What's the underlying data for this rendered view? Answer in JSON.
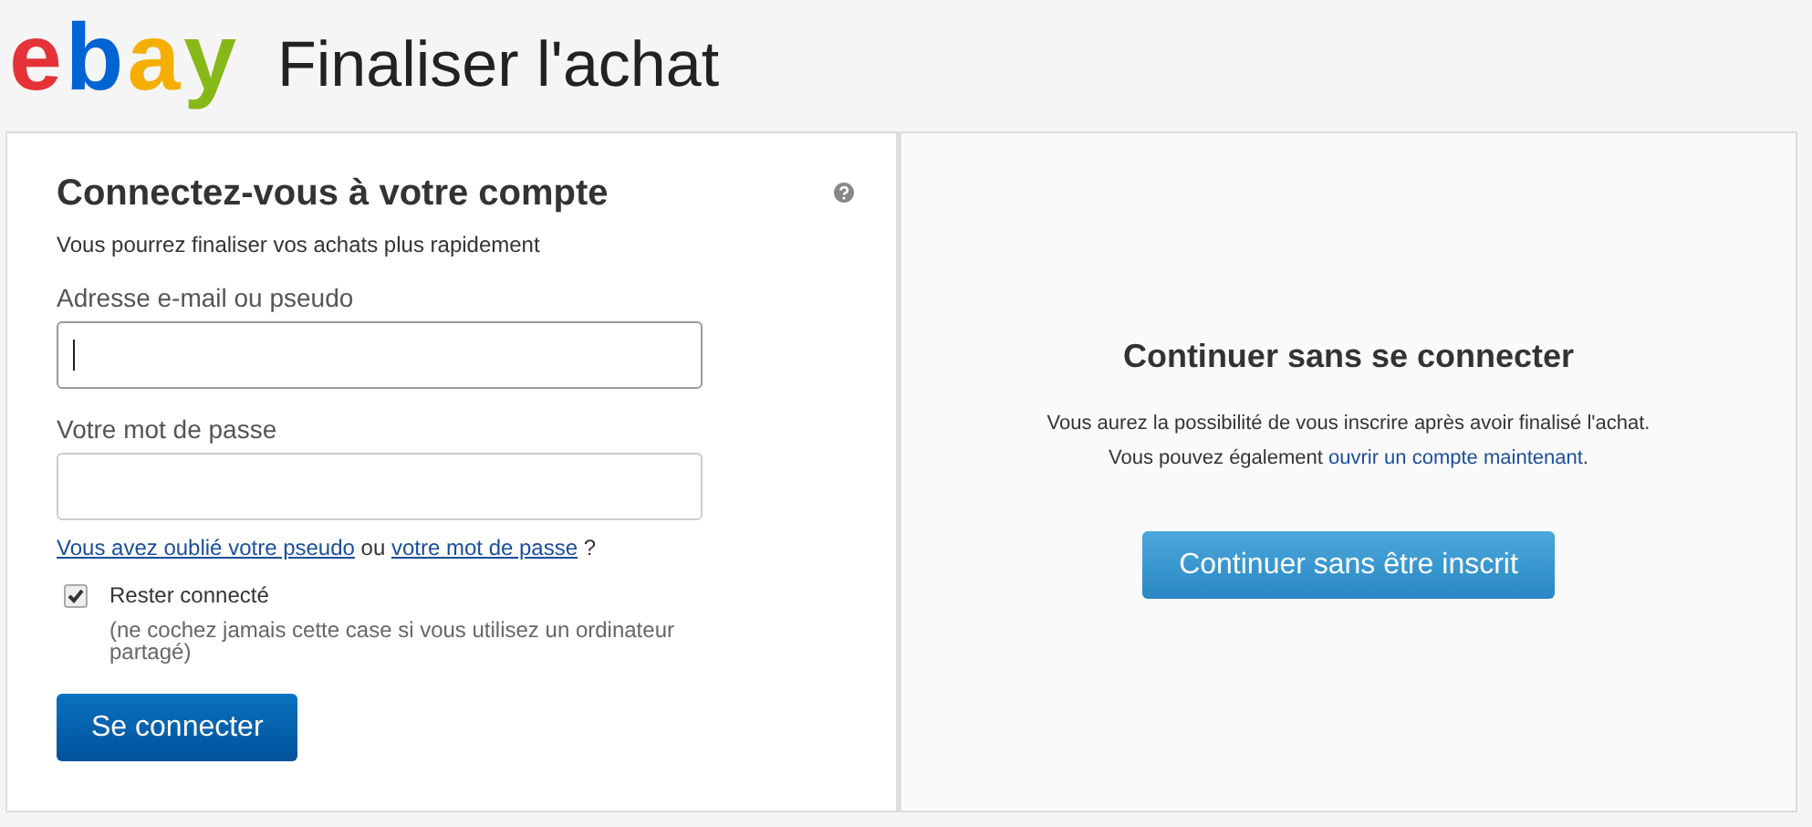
{
  "header": {
    "logo": [
      {
        "char": "e",
        "color": "#e53238"
      },
      {
        "char": "b",
        "color": "#0064d2"
      },
      {
        "char": "a",
        "color": "#f5af02"
      },
      {
        "char": "y",
        "color": "#86b817"
      }
    ],
    "title": "Finaliser l'achat"
  },
  "signin": {
    "title": "Connectez-vous à votre compte",
    "subtitle": "Vous pourrez finaliser vos achats plus rapidement",
    "fields": [
      {
        "label": "Adresse e-mail ou pseudo",
        "focused": true
      },
      {
        "label": "Votre mot de passe",
        "focused": false
      }
    ],
    "forgot": {
      "link_1": "Vous avez oublié votre pseudo",
      "middle": "ou",
      "link_2": "votre mot de passe",
      "end": "?"
    },
    "remember": {
      "label": "Rester connecté",
      "checked": true,
      "note": "(ne cochez jamais cette case si vous utilisez un ordinateur partagé)"
    },
    "button": "Se connecter"
  },
  "guest": {
    "title": "Continuer sans se connecter",
    "line_1": "Vous aurez la possibilité de vous inscrire après avoir finalisé l'achat.",
    "line_2": "Vous pouvez également",
    "link": "ouvrir un compte maintenant",
    "line_2_end": ".",
    "button": "Continuer sans être inscrit"
  }
}
